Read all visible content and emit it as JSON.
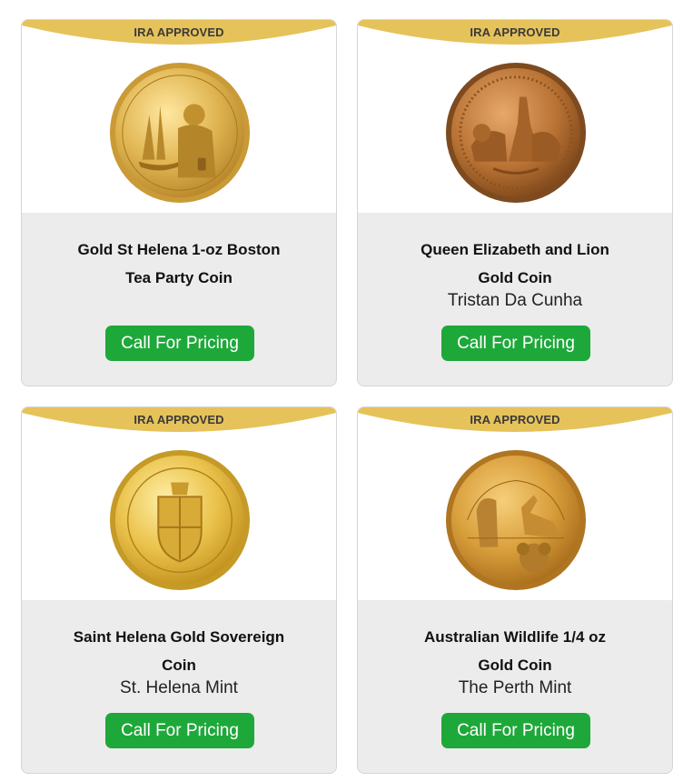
{
  "colors": {
    "accent_ribbon": "#e6c25a",
    "button_green": "#1ea83a",
    "card_bg": "#ececec"
  },
  "products": [
    {
      "badge": "IRA APPROVED",
      "name_line1": "Gold St Helena 1-oz Boston",
      "name_line2": "Tea Party Coin",
      "mint": "",
      "button": "Call For Pricing",
      "coin_icon": "boston-tea-party-coin-icon"
    },
    {
      "badge": "IRA APPROVED",
      "name_line1": "Queen Elizabeth and Lion",
      "name_line2": "Gold Coin",
      "mint": "Tristan Da Cunha",
      "button": "Call For Pricing",
      "coin_icon": "queen-lion-coin-icon"
    },
    {
      "badge": "IRA APPROVED",
      "name_line1": "Saint Helena Gold Sovereign",
      "name_line2": "Coin",
      "mint": "St. Helena Mint",
      "button": "Call For Pricing",
      "coin_icon": "sovereign-shield-coin-icon"
    },
    {
      "badge": "IRA APPROVED",
      "name_line1": "Australian Wildlife 1/4 oz",
      "name_line2": "Gold Coin",
      "mint": "The Perth Mint",
      "button": "Call For Pricing",
      "coin_icon": "australian-wildlife-coin-icon"
    }
  ]
}
